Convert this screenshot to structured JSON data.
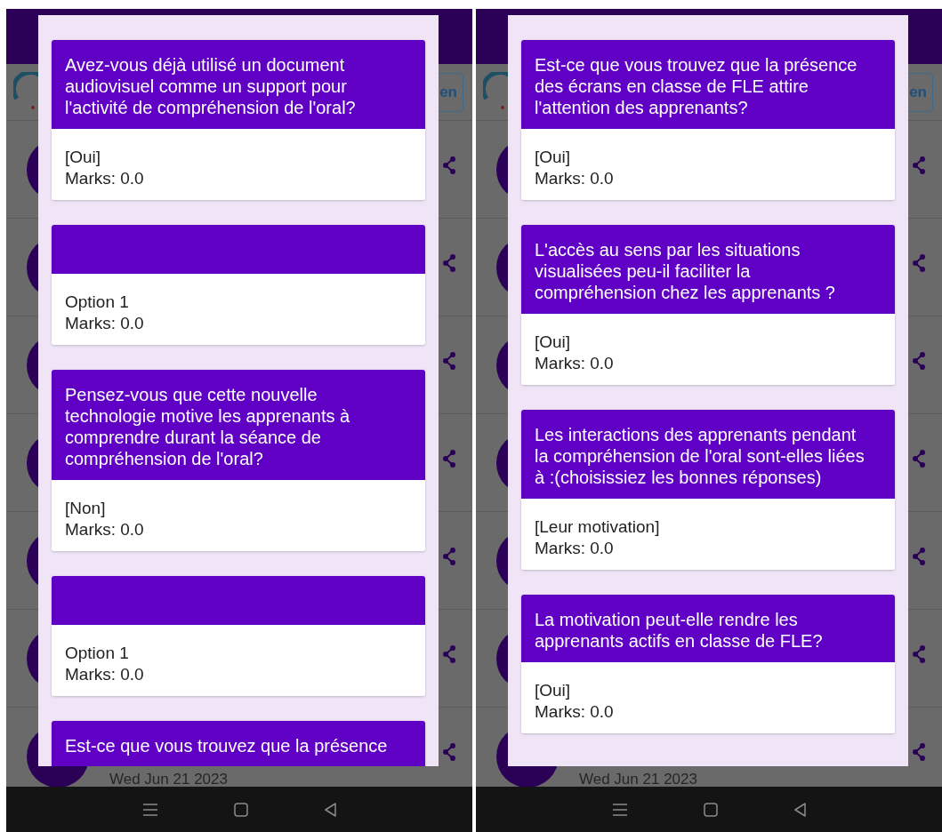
{
  "screens": [
    {
      "background": {
        "language_button": "en",
        "date": "Wed Jun 21 2023"
      },
      "dialog": {
        "answers": [
          {
            "question": "Avez-vous déjà utilisé un document audiovisuel comme un support pour l'activité de compréhension de l'oral?",
            "answer": "[Oui]",
            "marks": "Marks: 0.0"
          },
          {
            "answer": "Option 1",
            "marks": "Marks: 0.0"
          },
          {
            "question": "Pensez-vous que cette nouvelle technologie motive les apprenants à comprendre durant la séance de compréhension de l'oral?",
            "answer": "[Non]",
            "marks": "Marks: 0.0"
          },
          {
            "answer": "Option 1",
            "marks": "Marks: 0.0"
          },
          {
            "question": "Est-ce que vous trouvez que la présence"
          }
        ]
      }
    },
    {
      "background": {
        "language_button": "en",
        "date": "Wed Jun 21 2023"
      },
      "dialog": {
        "answers": [
          {
            "question": "Est-ce que vous trouvez que la présence des écrans en classe de FLE attire l'attention des apprenants?",
            "answer": "[Oui]",
            "marks": "Marks: 0.0"
          },
          {
            "question": "L'accès au sens par les situations visualisées peu-il faciliter la compréhension chez les apprenants ?",
            "answer": "[Oui]",
            "marks": "Marks: 0.0"
          },
          {
            "question": "Les interactions des apprenants pendant la compréhension de l'oral sont-elles liées à :(choisissiez les bonnes réponses)",
            "answer": "[Leur motivation]",
            "marks": "Marks: 0.0"
          },
          {
            "question": "La motivation peut-elle rendre les apprenants actifs en classe de FLE?",
            "answer": "[Oui]",
            "marks": "Marks: 0.0"
          }
        ]
      }
    }
  ]
}
